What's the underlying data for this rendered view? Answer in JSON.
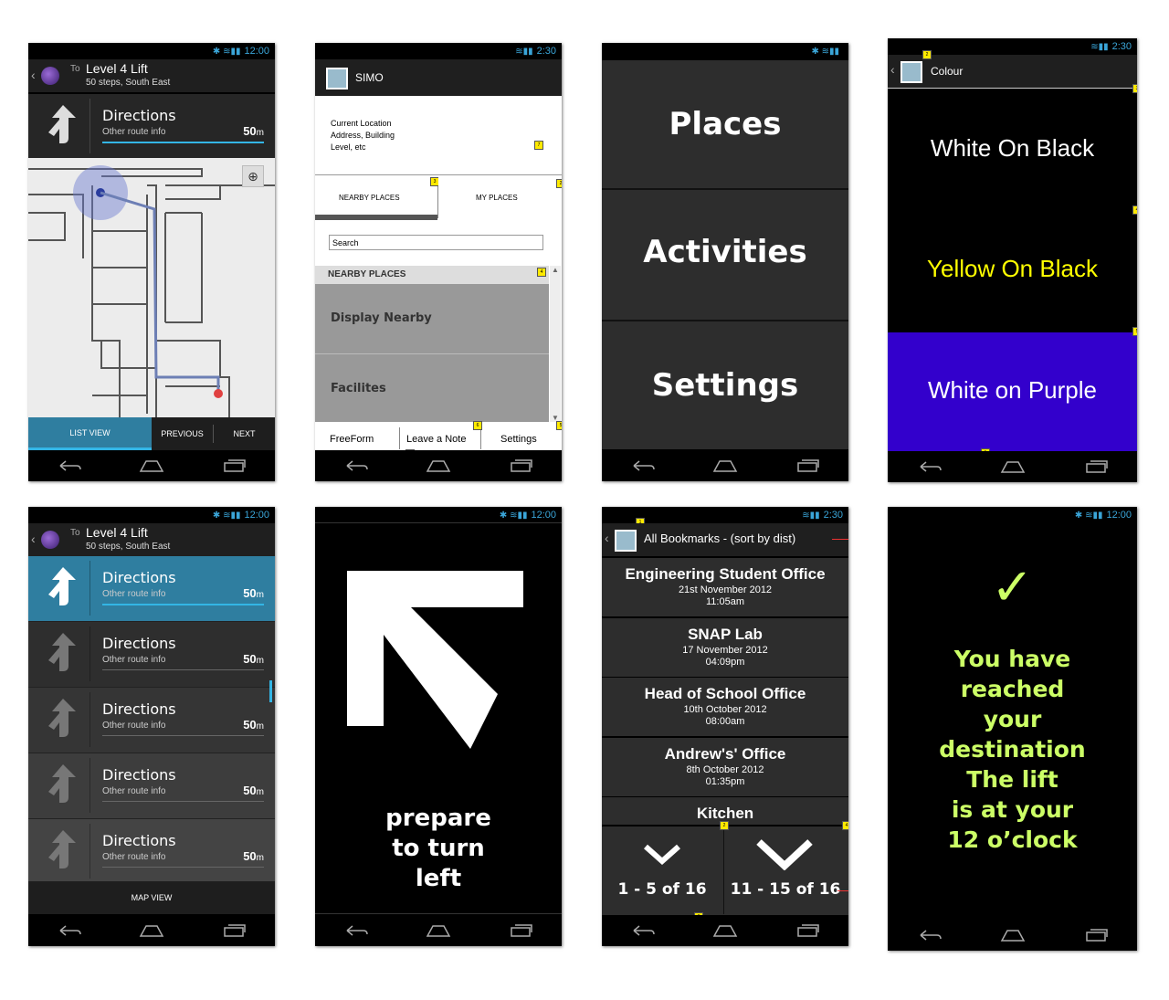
{
  "status": {
    "time_a": "12:00",
    "time_b": "2:30"
  },
  "route": {
    "to_prefix": "To",
    "title": "Level 4 Lift",
    "subtitle": "50 steps, South East"
  },
  "directions": {
    "title": "Directions",
    "subtitle": "Other route info",
    "distance": "50",
    "unit": "m"
  },
  "map_bottom": {
    "list_view": "LIST VIEW",
    "previous": "PREVIOUS",
    "next": "NEXT"
  },
  "simo": {
    "app_title": "SIMO",
    "location_lines": [
      "Current Location",
      "Address, Building",
      "Level, etc"
    ],
    "tab_nearby": "NEARBY PLACES",
    "tab_my": "MY PLACES",
    "search_placeholder": "Search",
    "section_header": "NEARBY PLACES",
    "items": [
      "Display Nearby",
      "Facilites"
    ],
    "bottom": [
      "FreeForm",
      "Leave a Note",
      "Settings"
    ]
  },
  "menu": {
    "items": [
      "Places",
      "Activities",
      "Settings"
    ]
  },
  "colour": {
    "title": "Colour",
    "options": [
      {
        "label": "White On Black",
        "fg": "#ffffff",
        "bg": "#000000"
      },
      {
        "label": "Yellow On Black",
        "fg": "#ffff00",
        "bg": "#000000"
      },
      {
        "label": "White on Purple",
        "fg": "#ffffff",
        "bg": "#3300cc"
      }
    ]
  },
  "list_bottom": {
    "map_view": "MAP VIEW"
  },
  "turn": {
    "lines": [
      "prepare",
      "to turn",
      "left"
    ]
  },
  "bookmarks": {
    "title": "All Bookmarks - (sort by dist)",
    "items": [
      {
        "name": "Engineering Student Office",
        "date": "21st November 2012",
        "time": "11:05am"
      },
      {
        "name": "SNAP Lab",
        "date": "17 November 2012",
        "time": "04:09pm"
      },
      {
        "name": "Head of School Office",
        "date": "10th October 2012",
        "time": "08:00am"
      },
      {
        "name": "Andrew's' Office",
        "date": "8th October 2012",
        "time": "01:35pm"
      },
      {
        "name": "Kitchen"
      }
    ],
    "page_prev": "1 - 5 of 16",
    "page_next": "11 - 15 of 16"
  },
  "arrival": {
    "check": "✓",
    "lines": [
      "You have",
      "reached",
      "your",
      "destination",
      "The lift",
      "is at your",
      "12 o’clock"
    ]
  },
  "tags": [
    "1",
    "2",
    "3",
    "4",
    "5",
    "6",
    "7"
  ],
  "colors": {
    "accent": "#33b5e5",
    "list_selected": "#2f7ea0",
    "arrival_text": "#ccff66",
    "purple": "#3300cc"
  }
}
